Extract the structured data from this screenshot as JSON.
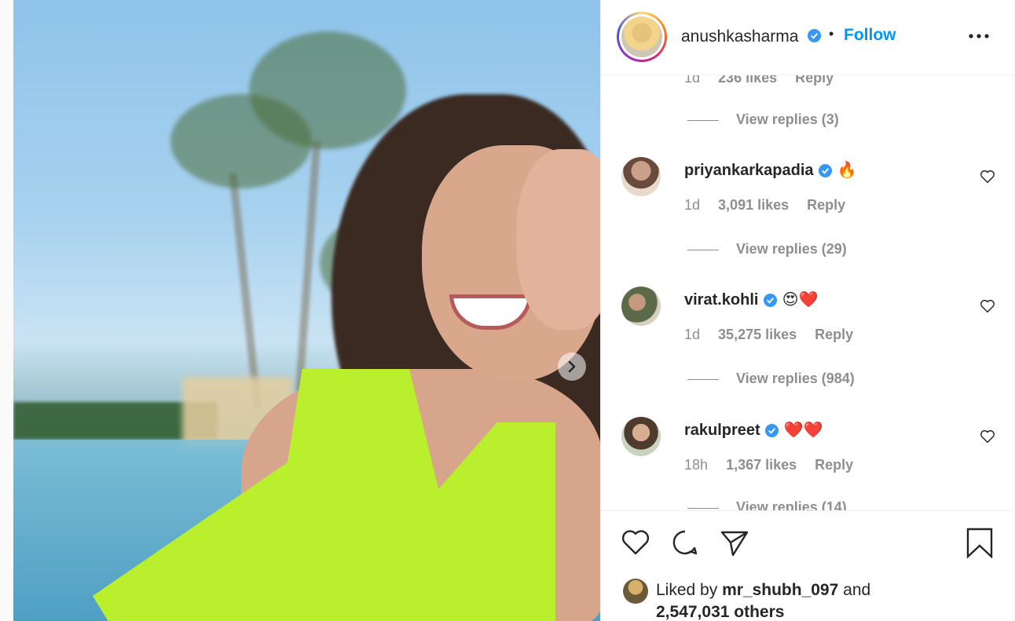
{
  "post": {
    "author": "anushkasharma",
    "follow_label": "Follow",
    "separator": "•"
  },
  "partial_comment": {
    "time": "1d",
    "likes": "236 likes",
    "reply": "Reply",
    "view_replies": "View replies (3)"
  },
  "comments": [
    {
      "user": "priyankarkapadia",
      "emoji": "🔥",
      "time": "1d",
      "likes": "3,091 likes",
      "reply": "Reply",
      "view_replies": "View replies (29)"
    },
    {
      "user": "virat.kohli",
      "emoji": "😍❤️",
      "time": "1d",
      "likes": "35,275 likes",
      "reply": "Reply",
      "view_replies": "View replies (984)"
    },
    {
      "user": "rakulpreet",
      "emoji": "❤️❤️",
      "time": "18h",
      "likes": "1,367 likes",
      "reply": "Reply",
      "view_replies": "View replies (14)"
    }
  ],
  "liked_by": {
    "prefix": "Liked by",
    "user": "mr_shubh_097",
    "middle": "and",
    "others": "2,547,031 others"
  },
  "icons": {
    "verified": "verified-badge-icon",
    "more": "more-options-icon",
    "next": "chevron-right-icon",
    "like": "heart-icon",
    "comment": "comment-icon",
    "share": "paper-plane-icon",
    "save": "bookmark-icon"
  },
  "colors": {
    "accent": "#0095f6",
    "muted": "#8e8e8e",
    "verified": "#3897f0"
  }
}
